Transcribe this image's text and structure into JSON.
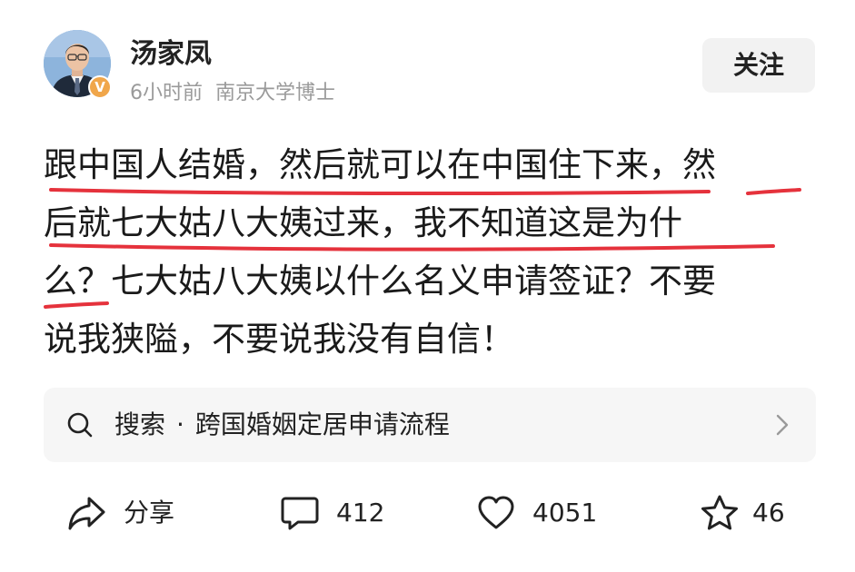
{
  "author": {
    "name": "汤家凤",
    "time": "6小时前",
    "title": "南京大学博士",
    "verified_mark": "V",
    "avatar": "avatar-photo"
  },
  "follow_button": {
    "label": "关注"
  },
  "post": {
    "lines": [
      "跟中国人结婚，然后就可以在中国住下来，然",
      "后就七大姑八大姨过来，我不知道这是为什",
      "么？七大姑八大姨以什么名义申请签证？不要",
      "说我狭隘，不要说我没有自信！"
    ],
    "underline_color": "#e5323c"
  },
  "search_suggestion": {
    "prefix": "搜索",
    "separator": "·",
    "query": "跨国婚姻定居申请流程",
    "icon": "search-icon",
    "chevron": "chevron-right-icon"
  },
  "actions": {
    "share": {
      "label": "分享",
      "icon": "share-icon"
    },
    "comment": {
      "count": "412",
      "icon": "comment-icon"
    },
    "like": {
      "count": "4051",
      "icon": "heart-icon"
    },
    "favorite": {
      "count": "46",
      "icon": "star-icon"
    }
  },
  "colors": {
    "badge": "#f0a64a",
    "meta_text": "#9a9a9a",
    "button_bg": "#f2f2f2",
    "search_bg": "#f6f6f6"
  }
}
